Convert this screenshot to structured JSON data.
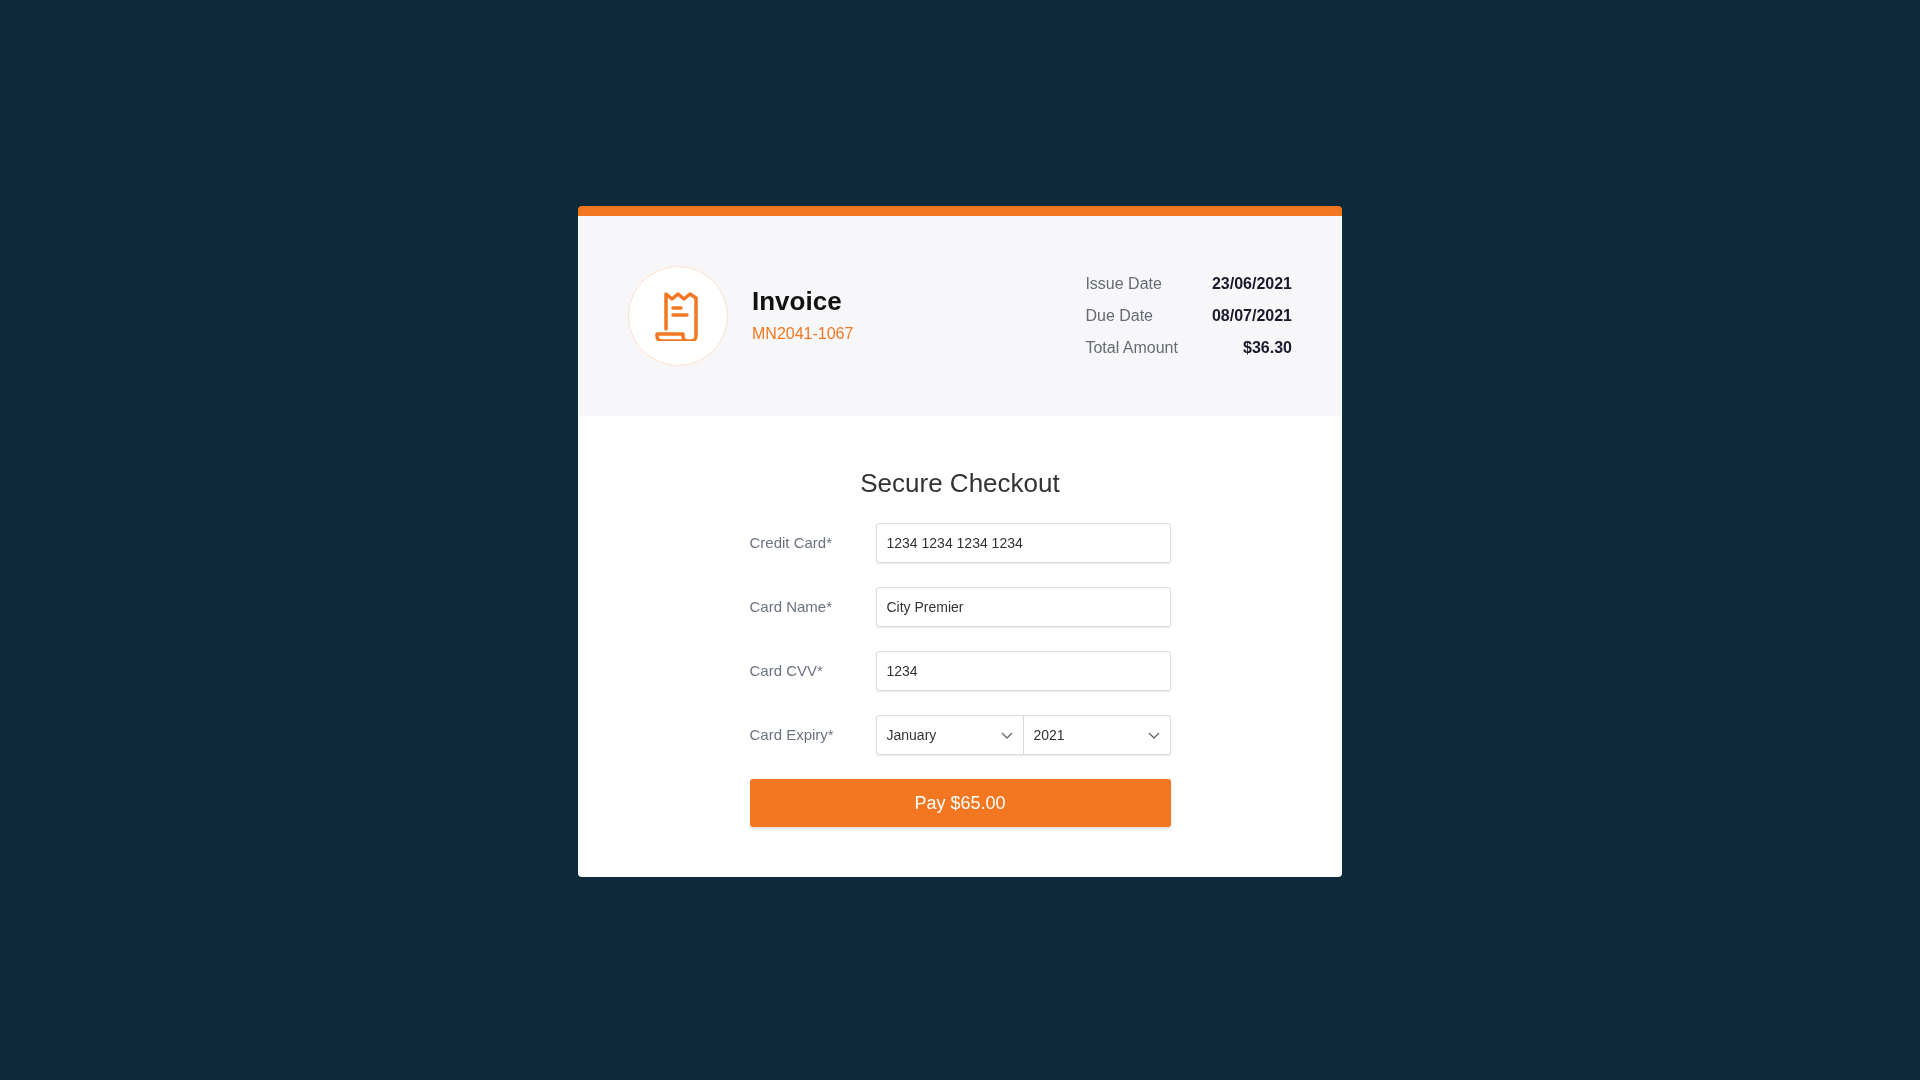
{
  "invoice": {
    "title": "Invoice",
    "number": "MN2041-1067",
    "details": [
      {
        "label": "Issue Date",
        "value": "23/06/2021"
      },
      {
        "label": "Due Date",
        "value": "08/07/2021"
      },
      {
        "label": "Total Amount",
        "value": "$36.30"
      }
    ]
  },
  "checkout": {
    "title": "Secure Checkout",
    "fields": [
      {
        "kind": "text",
        "label": "Credit Card*",
        "value": "1234 1234 1234 1234"
      },
      {
        "kind": "text",
        "label": "Card Name*",
        "value": "City Premier"
      },
      {
        "kind": "text",
        "label": "Card CVV*",
        "value": "1234"
      },
      {
        "kind": "selects",
        "label": "Card Expiry*",
        "values": [
          "January",
          "2021"
        ]
      }
    ],
    "button": "Pay $65.00"
  }
}
